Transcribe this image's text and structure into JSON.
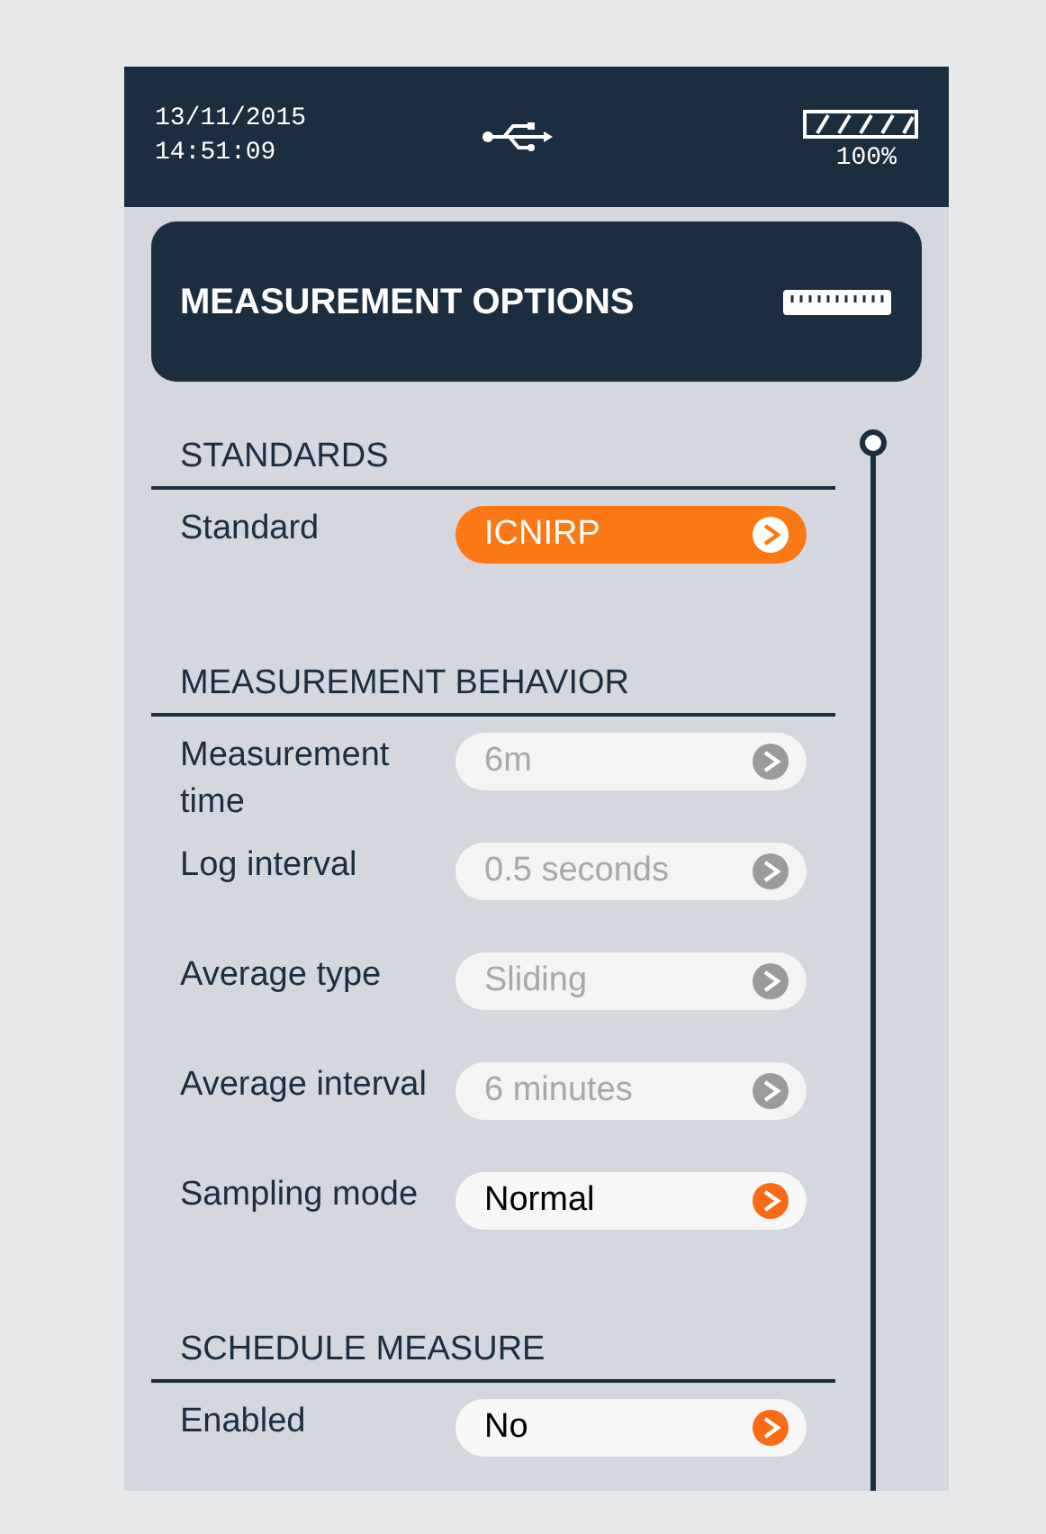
{
  "status_bar": {
    "date": "13/11/2015",
    "time": "14:51:09",
    "battery": "100%"
  },
  "title": "MEASUREMENT OPTIONS",
  "sections": [
    {
      "heading": "STANDARDS",
      "items": [
        {
          "label": "Standard",
          "value": "ICNIRP",
          "selected": true,
          "disabled": false
        }
      ]
    },
    {
      "heading": "MEASUREMENT BEHAVIOR",
      "items": [
        {
          "label": "Measurement time",
          "value": "6m",
          "selected": false,
          "disabled": true
        },
        {
          "label": "Log interval",
          "value": "0.5 seconds",
          "selected": false,
          "disabled": true
        },
        {
          "label": "Average type",
          "value": "Sliding",
          "selected": false,
          "disabled": true
        },
        {
          "label": "Average interval",
          "value": "6 minutes",
          "selected": false,
          "disabled": true
        },
        {
          "label": "Sampling mode",
          "value": "Normal",
          "selected": false,
          "disabled": false
        }
      ]
    },
    {
      "heading": "SCHEDULE MEASURE",
      "items": [
        {
          "label": "Enabled",
          "value": "No",
          "selected": false,
          "disabled": false
        }
      ]
    }
  ]
}
